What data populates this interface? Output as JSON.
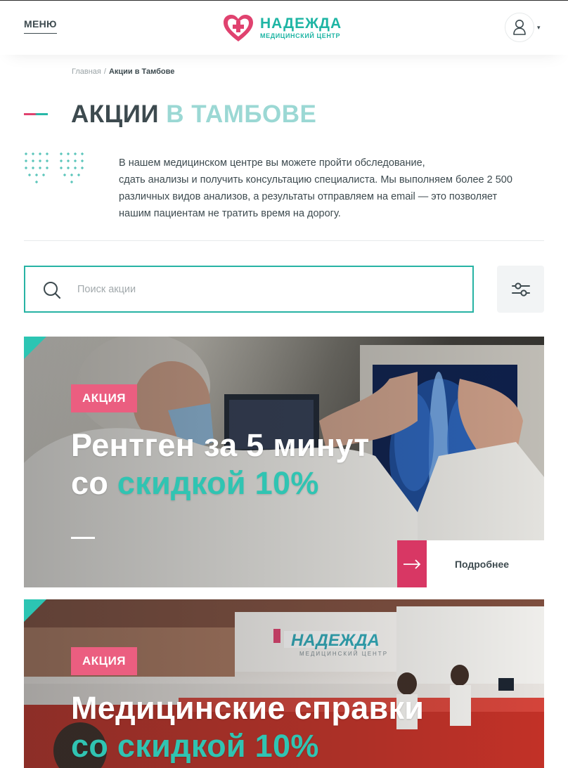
{
  "header": {
    "menu_label": "МЕНЮ",
    "logo_name": "НАДЕЖДА",
    "logo_subtitle": "МЕДИЦИНСКИЙ ЦЕНТР",
    "user_icon": "user-icon",
    "caret": "▾"
  },
  "breadcrumb": {
    "home": "Главная",
    "separator": "/",
    "current": "Акции в Тамбове"
  },
  "page": {
    "title_dark": "АКЦИИ",
    "title_accent": "В ТАМБОВЕ",
    "intro_lines": [
      "В нашем медицинском центре вы можете пройти обследование,",
      "сдать анализы и получить консультацию специалиста. Мы выполняем более 2 500",
      "различных видов анализов, а результаты отправляем на email — это позволяет",
      "нашим пациентам не тратить время на дорогу."
    ]
  },
  "search": {
    "placeholder": "Поиск акции",
    "value": "",
    "search_icon": "search-icon",
    "filter_icon": "filter-sliders-icon"
  },
  "promos": [
    {
      "badge": "АКЦИЯ",
      "line1": "Рентген за 5 минут",
      "line2_plain": "со ",
      "line2_accent": "скидкой 10%",
      "more_label": "Подробнее"
    },
    {
      "badge": "АКЦИЯ",
      "line1": "Медицинские справки",
      "line2_plain": "",
      "line2_accent": "со скидкой 10%",
      "more_label": ""
    }
  ],
  "colors": {
    "teal": "#27b3a4",
    "pink": "#eb5e80",
    "dark_pink": "#d83764",
    "text": "#3d4a4f",
    "light_teal": "#9bd8d4"
  }
}
